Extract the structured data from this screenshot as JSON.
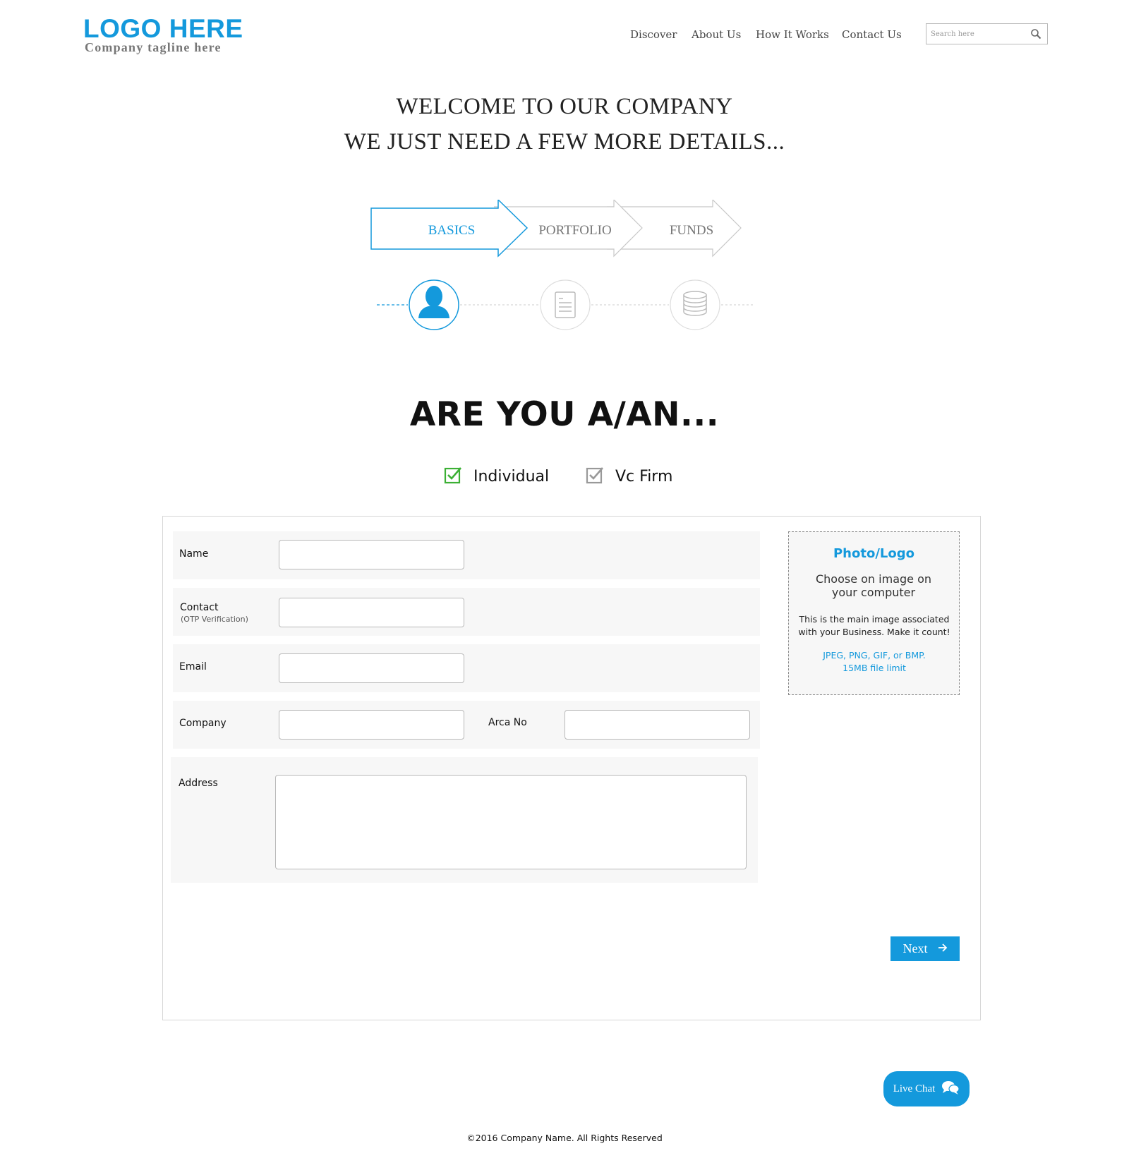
{
  "logo": {
    "title": "LOGO HERE",
    "tagline": "Company tagline here",
    "brand_color": "#1499dc"
  },
  "nav": {
    "items": [
      "Discover",
      "About Us",
      "How It Works",
      "Contact Us"
    ]
  },
  "search": {
    "placeholder": "Search here",
    "icon": "search-icon"
  },
  "welcome": {
    "line1": "WELCOME TO OUR COMPANY",
    "line2": "WE JUST NEED A FEW MORE DETAILS..."
  },
  "steps": {
    "items": [
      {
        "label": "BASICS",
        "icon": "user-icon",
        "active": true
      },
      {
        "label": "PORTFOLIO",
        "icon": "document-icon",
        "active": false
      },
      {
        "label": "FUNDS",
        "icon": "coins-icon",
        "active": false
      }
    ],
    "active_color": "#1499dc",
    "inactive_color": "#bbbbbb"
  },
  "question": {
    "title": "ARE YOU A/AN...",
    "options": [
      {
        "label": "Individual",
        "checked": true,
        "color": "#3cb035"
      },
      {
        "label": "Vc Firm",
        "checked": false,
        "color": "#999999"
      }
    ]
  },
  "form": {
    "name_label": "Name",
    "contact_label": "Contact",
    "contact_sublabel": "(OTP Verification)",
    "email_label": "Email",
    "company_label": "Company",
    "arca_label": "Arca No",
    "address_label": "Address",
    "name_value": "",
    "contact_value": "",
    "email_value": "",
    "company_value": "",
    "arca_value": "",
    "address_value": ""
  },
  "upload": {
    "title": "Photo/Logo",
    "choose": "Choose on image on your computer",
    "description": "This is the main image associated with your Business. Make it count!",
    "formats": "JPEG, PNG, GIF, or BMP.",
    "limit": "15MB file limit"
  },
  "actions": {
    "next_label": "Next",
    "chat_label": "Live Chat"
  },
  "footer": {
    "text": "©2016 Company Name. All Rights Reserved"
  }
}
